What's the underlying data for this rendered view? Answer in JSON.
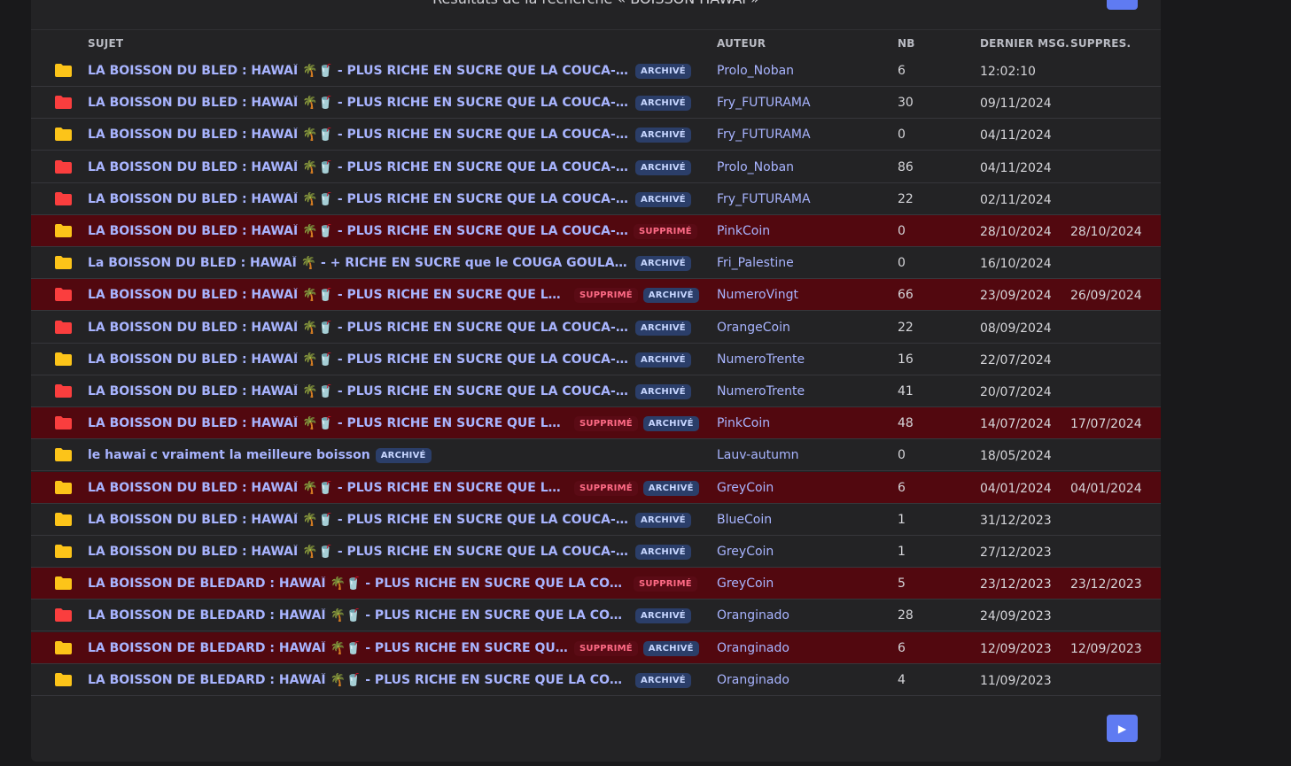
{
  "title": "Résultats de la recherche « BOISSON HAWAÏ »",
  "columns": {
    "subject": "SUJET",
    "author": "AUTEUR",
    "count": "NB",
    "last": "DERNIER MSG.",
    "deleted": "SUPPRES."
  },
  "badges": {
    "archived": "ARCHIVÉ",
    "deleted": "SUPPRIMÉ"
  },
  "colors": {
    "folder_yellow": "#fcc419",
    "folder_red": "#fa3e3e",
    "link": "#a8b4ff",
    "deleted_row": "#52080f",
    "button": "#5f7bf2"
  },
  "next_icon": "▶",
  "topics": [
    {
      "folder": "yellow",
      "subject": "LA BOISSON DU BLED : HAWAÏ 🌴🥤 - PLUS RICHE EN SUCRE QUE LA COUCA-COULA ...",
      "deleted": false,
      "archived": true,
      "author": "Prolo_Noban",
      "count": "6",
      "last": "12:02:10",
      "deleted_date": ""
    },
    {
      "folder": "red",
      "subject": "LA BOISSON DU BLED : HAWAÏ 🌴🥤 - PLUS RICHE EN SUCRE QUE LA COUCA-COULA ...",
      "deleted": false,
      "archived": true,
      "author": "Fry_FUTURAMA",
      "count": "30",
      "last": "09/11/2024",
      "deleted_date": ""
    },
    {
      "folder": "yellow",
      "subject": "LA BOISSON DU BLED : HAWAÏ 🌴🥤 - PLUS RICHE EN SUCRE QUE LA COUCA-COULA ...",
      "deleted": false,
      "archived": true,
      "author": "Fry_FUTURAMA",
      "count": "0",
      "last": "04/11/2024",
      "deleted_date": ""
    },
    {
      "folder": "red",
      "subject": "LA BOISSON DU BLED : HAWAÏ 🌴🥤 - PLUS RICHE EN SUCRE QUE LA COUCA-COULA ...",
      "deleted": false,
      "archived": true,
      "author": "Prolo_Noban",
      "count": "86",
      "last": "04/11/2024",
      "deleted_date": ""
    },
    {
      "folder": "red",
      "subject": "LA BOISSON DU BLED : HAWAÏ 🌴🥤 - PLUS RICHE EN SUCRE QUE LA COUCA-COULA ...",
      "deleted": false,
      "archived": true,
      "author": "Fry_FUTURAMA",
      "count": "22",
      "last": "02/11/2024",
      "deleted_date": ""
    },
    {
      "folder": "yellow",
      "subject": "LA BOISSON DU BLED : HAWAÏ 🌴🥤 - PLUS RICHE EN SUCRE QUE LA COUCA-COULA...",
      "deleted": true,
      "archived": false,
      "author": "PinkCoin",
      "count": "0",
      "last": "28/10/2024",
      "deleted_date": "28/10/2024"
    },
    {
      "folder": "yellow",
      "subject": "La BOISSON DU BLED : HAWAÏ 🌴 - + RICHE EN SUCRE que le COUGA GOULA américa...",
      "deleted": false,
      "archived": true,
      "author": "Fri_Palestine",
      "count": "0",
      "last": "16/10/2024",
      "deleted_date": ""
    },
    {
      "folder": "red",
      "subject": "LA BOISSON DU BLED : HAWAÏ 🌴🥤 - PLUS RICHE EN SUCRE QUE LA COUC...",
      "deleted": true,
      "archived": true,
      "author": "NumeroVingt",
      "count": "66",
      "last": "23/09/2024",
      "deleted_date": "26/09/2024"
    },
    {
      "folder": "red",
      "subject": "LA BOISSON DU BLED : HAWAÏ 🌴🥤 - PLUS RICHE EN SUCRE QUE LA COUCA-COULA ...",
      "deleted": false,
      "archived": true,
      "author": "OrangeCoin",
      "count": "22",
      "last": "08/09/2024",
      "deleted_date": ""
    },
    {
      "folder": "yellow",
      "subject": "LA BOISSON DU BLED : HAWAÏ 🌴🥤 - PLUS RICHE EN SUCRE QUE LA COUCA-COULA ...",
      "deleted": false,
      "archived": true,
      "author": "NumeroTrente",
      "count": "16",
      "last": "22/07/2024",
      "deleted_date": ""
    },
    {
      "folder": "red",
      "subject": "LA BOISSON DU BLED : HAWAÏ 🌴🥤 - PLUS RICHE EN SUCRE QUE LA COUCA-COULA ...",
      "deleted": false,
      "archived": true,
      "author": "NumeroTrente",
      "count": "41",
      "last": "20/07/2024",
      "deleted_date": ""
    },
    {
      "folder": "red",
      "subject": "LA BOISSON DU BLED : HAWAÏ 🌴🥤 - PLUS RICHE EN SUCRE QUE LA COUC...",
      "deleted": true,
      "archived": true,
      "author": "PinkCoin",
      "count": "48",
      "last": "14/07/2024",
      "deleted_date": "17/07/2024"
    },
    {
      "folder": "yellow",
      "subject": "le hawai c vraiment la meilleure boisson",
      "deleted": false,
      "archived": true,
      "author": "Lauv-autumn",
      "count": "0",
      "last": "18/05/2024",
      "deleted_date": ""
    },
    {
      "folder": "yellow",
      "subject": "LA BOISSON DU BLED : HAWAÏ 🌴🥤 - PLUS RICHE EN SUCRE QUE LA COUC...",
      "deleted": true,
      "archived": true,
      "author": "GreyCoin",
      "count": "6",
      "last": "04/01/2024",
      "deleted_date": "04/01/2024"
    },
    {
      "folder": "yellow",
      "subject": "LA BOISSON DU BLED : HAWAÏ 🌴🥤 - PLUS RICHE EN SUCRE QUE LA COUCA-COULA ...",
      "deleted": false,
      "archived": true,
      "author": "BlueCoin",
      "count": "1",
      "last": "31/12/2023",
      "deleted_date": ""
    },
    {
      "folder": "yellow",
      "subject": "LA BOISSON DU BLED : HAWAÏ 🌴🥤 - PLUS RICHE EN SUCRE QUE LA COUCA-COULA ...",
      "deleted": false,
      "archived": true,
      "author": "GreyCoin",
      "count": "1",
      "last": "27/12/2023",
      "deleted_date": ""
    },
    {
      "folder": "yellow",
      "subject": "LA BOISSON DE BLEDARD : HAWAÏ 🌴🥤 - PLUS RICHE EN SUCRE QUE LA COUCA-CO...",
      "deleted": true,
      "archived": false,
      "author": "GreyCoin",
      "count": "5",
      "last": "23/12/2023",
      "deleted_date": "23/12/2023"
    },
    {
      "folder": "red",
      "subject": "LA BOISSON DE BLEDARD : HAWAÏ 🌴🥤 - PLUS RICHE EN SUCRE QUE LA COUCA-CO...",
      "deleted": false,
      "archived": true,
      "author": "Oranginado",
      "count": "28",
      "last": "24/09/2023",
      "deleted_date": ""
    },
    {
      "folder": "yellow",
      "subject": "LA BOISSON DE BLEDARD : HAWAÏ 🌴🥤 - PLUS RICHE EN SUCRE QUE LA C...",
      "deleted": true,
      "archived": true,
      "author": "Oranginado",
      "count": "6",
      "last": "12/09/2023",
      "deleted_date": "12/09/2023"
    },
    {
      "folder": "yellow",
      "subject": "LA BOISSON DE BLEDARD : HAWAÏ 🌴🥤 - PLUS RICHE EN SUCRE QUE LA COUCA-CO...",
      "deleted": false,
      "archived": true,
      "author": "Oranginado",
      "count": "4",
      "last": "11/09/2023",
      "deleted_date": ""
    }
  ]
}
